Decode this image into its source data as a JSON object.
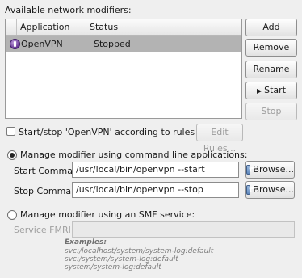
{
  "section": {
    "title": "Available network modifiers:"
  },
  "table": {
    "columns": [
      "Application Name",
      "Status"
    ],
    "rows": [
      {
        "icon": "openvpn-icon",
        "name": "OpenVPN",
        "status": "Stopped",
        "selected": true
      }
    ]
  },
  "buttons": {
    "add": "Add",
    "remove": "Remove",
    "rename": "Rename",
    "start": "Start",
    "stop": "Stop",
    "edit_rules": "Edit Rules..."
  },
  "start_stop_rule": {
    "label": "Start/stop 'OpenVPN' according to rules",
    "checked": false
  },
  "cli": {
    "label": "Manage modifier using command line applications:",
    "selected": true,
    "start_label": "Start Command:",
    "start_value": "/usr/local/bin/openvpn --start",
    "stop_label": "Stop Command:",
    "stop_value": "/usr/local/bin/openvpn --stop",
    "browse": "Browse..."
  },
  "smf": {
    "label": "Manage modifier using an SMF service:",
    "selected": false,
    "fmri_label": "Service FMRI:",
    "fmri_value": "",
    "examples_title": "Examples:",
    "examples": [
      "svc:/localhost/system/system-log:default",
      "svc:/system/system-log:default",
      "system/system-log:default"
    ]
  }
}
